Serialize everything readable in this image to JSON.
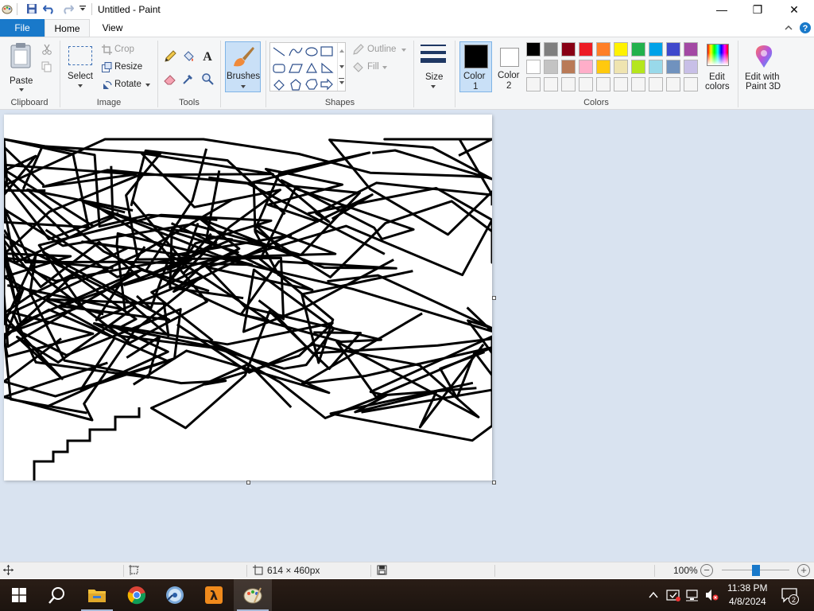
{
  "window": {
    "title": "Untitled - Paint",
    "minimize_glyph": "—",
    "maximize_glyph": "❐",
    "close_glyph": "✕"
  },
  "tabs": {
    "file": "File",
    "home": "Home",
    "view": "View"
  },
  "ribbon": {
    "clipboard": {
      "label": "Clipboard",
      "paste": "Paste"
    },
    "image": {
      "label": "Image",
      "select": "Select",
      "crop": "Crop",
      "resize": "Resize",
      "rotate": "Rotate"
    },
    "tools": {
      "label": "Tools"
    },
    "brushes": {
      "label": "Brushes"
    },
    "shapes": {
      "label": "Shapes",
      "outline": "Outline",
      "fill": "Fill"
    },
    "size": {
      "label": "Size"
    },
    "color1": {
      "line1": "Color",
      "line2": "1"
    },
    "color2": {
      "line1": "Color",
      "line2": "2"
    },
    "colors": {
      "label": "Colors",
      "row1": [
        "#000000",
        "#7f7f7f",
        "#880015",
        "#ed1c24",
        "#ff7f27",
        "#fff200",
        "#22b14c",
        "#00a2e8",
        "#3f48cc",
        "#a349a4"
      ],
      "row2": [
        "#ffffff",
        "#c3c3c3",
        "#b97a57",
        "#ffaec9",
        "#ffc90e",
        "#efe4b0",
        "#b5e61d",
        "#99d9ea",
        "#7092be",
        "#c8bfe7"
      ],
      "row3": [
        "#f5f5f5",
        "#f5f5f5",
        "#f5f5f5",
        "#f5f5f5",
        "#f5f5f5",
        "#f5f5f5",
        "#f5f5f5",
        "#f5f5f5",
        "#f5f5f5",
        "#f5f5f5"
      ],
      "color1_value": "#000000",
      "color2_value": "#ffffff"
    },
    "edit_colors": {
      "line1": "Edit",
      "line2": "colors"
    },
    "paint3d": {
      "line1": "Edit with",
      "line2": "Paint 3D"
    }
  },
  "status": {
    "dimensions": "614 × 460px",
    "zoom": "100%",
    "zoom_level": 0.5
  },
  "taskbar": {
    "time": "11:38 PM",
    "date": "4/8/2024",
    "notifications": "2"
  }
}
